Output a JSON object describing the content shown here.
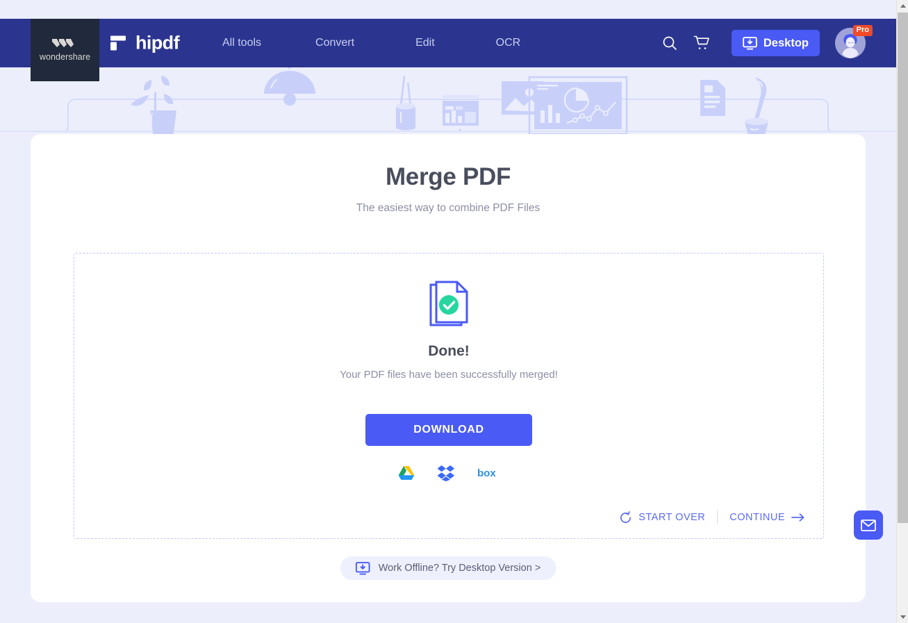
{
  "header": {
    "brand_block": {
      "logo_name": "wondershare-logo",
      "company": "wondershare"
    },
    "product": {
      "logo_name": "hipdf-logo",
      "name": "hipdf"
    },
    "nav": [
      {
        "label": "All tools",
        "name": "nav-all-tools"
      },
      {
        "label": "Convert",
        "name": "nav-convert"
      },
      {
        "label": "Edit",
        "name": "nav-edit"
      },
      {
        "label": "OCR",
        "name": "nav-ocr"
      }
    ],
    "search_icon": "search-icon",
    "cart_icon": "cart-icon",
    "desktop_button": {
      "label": "Desktop",
      "icon": "download-desktop-icon"
    },
    "account": {
      "badge": "Pro",
      "avatar_icon": "user-avatar"
    },
    "colors": {
      "bar": "#2b3590",
      "brand_block": "#212a3c",
      "accent": "#4a5af5",
      "pro_badge": "#f04a28"
    }
  },
  "hero": {
    "art_name": "desk-illustration",
    "items": [
      "potted-plant",
      "hanging-lamp",
      "pen-cup",
      "small-chart",
      "photo-frame",
      "dashboard-chart",
      "document-sheet",
      "coffee-cup"
    ]
  },
  "main": {
    "title": "Merge PDF",
    "subtitle": "The easiest way to combine PDF Files",
    "result": {
      "icon": "document-success-icon",
      "heading": "Done!",
      "description": "Your PDF files have been successfully merged!",
      "download_label": "DOWNLOAD"
    },
    "cloud_targets": [
      {
        "label": "Google Drive",
        "name": "google-drive-icon"
      },
      {
        "label": "Dropbox",
        "name": "dropbox-icon"
      },
      {
        "label": "Box",
        "name": "box-icon"
      }
    ],
    "actions": {
      "start_over": {
        "label": "START OVER",
        "icon": "restart-icon"
      },
      "continue": {
        "label": "CONTINUE",
        "icon": "arrow-right-icon"
      }
    },
    "offline_banner": {
      "label": "Work Offline? Try Desktop Version >",
      "icon": "download-desktop-icon"
    },
    "colors": {
      "title": "#4a4d5c",
      "subtitle": "#8b8fa3",
      "link": "#5b6bf0",
      "dropzone_border": "#c2caf5"
    }
  },
  "floating": {
    "mail_button": {
      "name": "mail-feedback-button",
      "icon": "envelope-icon"
    }
  },
  "scrollbar": {
    "up_icon": "scroll-up-arrow",
    "down_icon": "scroll-down-arrow",
    "thumb_name": "scroll-thumb"
  }
}
